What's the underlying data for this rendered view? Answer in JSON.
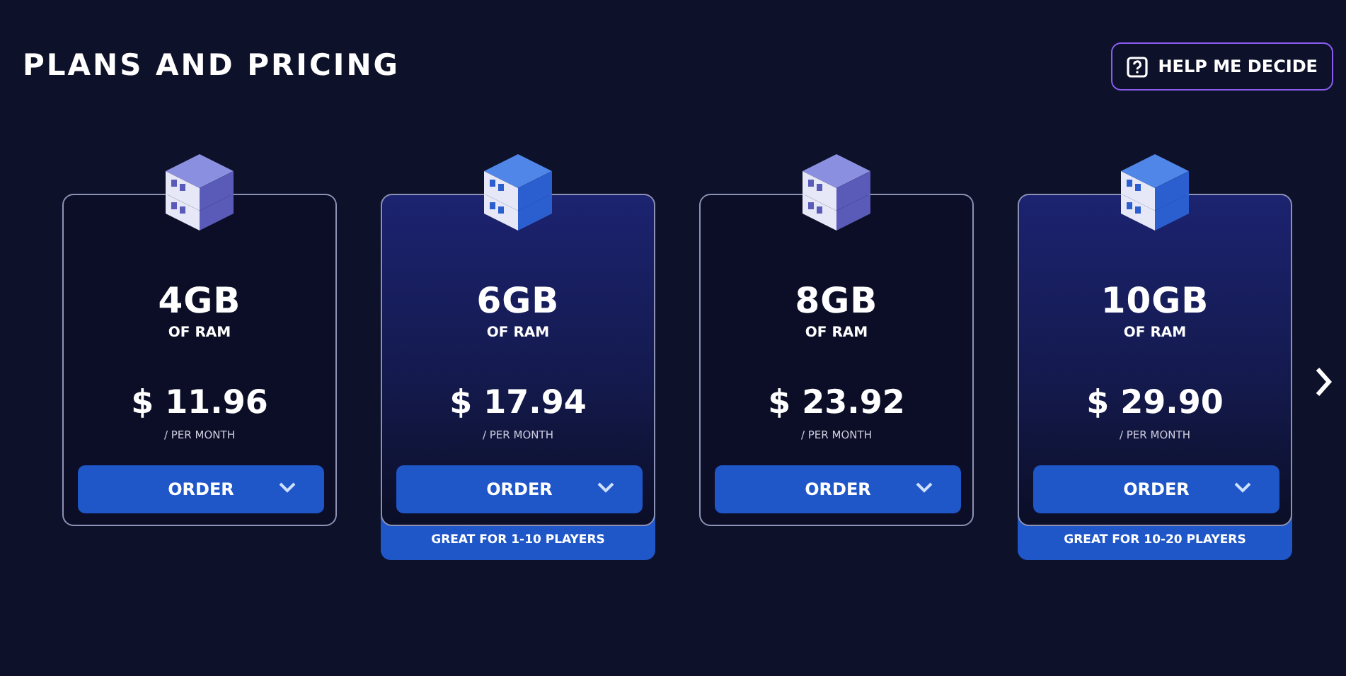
{
  "header": {
    "title": "PLANS AND PRICING",
    "help_button": "HELP ME DECIDE"
  },
  "plans": [
    {
      "size": "4GB",
      "unit": "OF RAM",
      "price": "$ 11.96",
      "period": "/ PER MONTH",
      "button": "ORDER",
      "featured": false
    },
    {
      "size": "6GB",
      "unit": "OF RAM",
      "price": "$ 17.94",
      "period": "/ PER MONTH",
      "button": "ORDER",
      "featured": true,
      "note": "GREAT FOR 1-10 PLAYERS"
    },
    {
      "size": "8GB",
      "unit": "OF RAM",
      "price": "$ 23.92",
      "period": "/ PER MONTH",
      "button": "ORDER",
      "featured": false
    },
    {
      "size": "10GB",
      "unit": "OF RAM",
      "price": "$ 29.90",
      "period": "/ PER MONTH",
      "button": "ORDER",
      "featured": true,
      "note": "GREAT FOR 10-20 PLAYERS"
    }
  ]
}
